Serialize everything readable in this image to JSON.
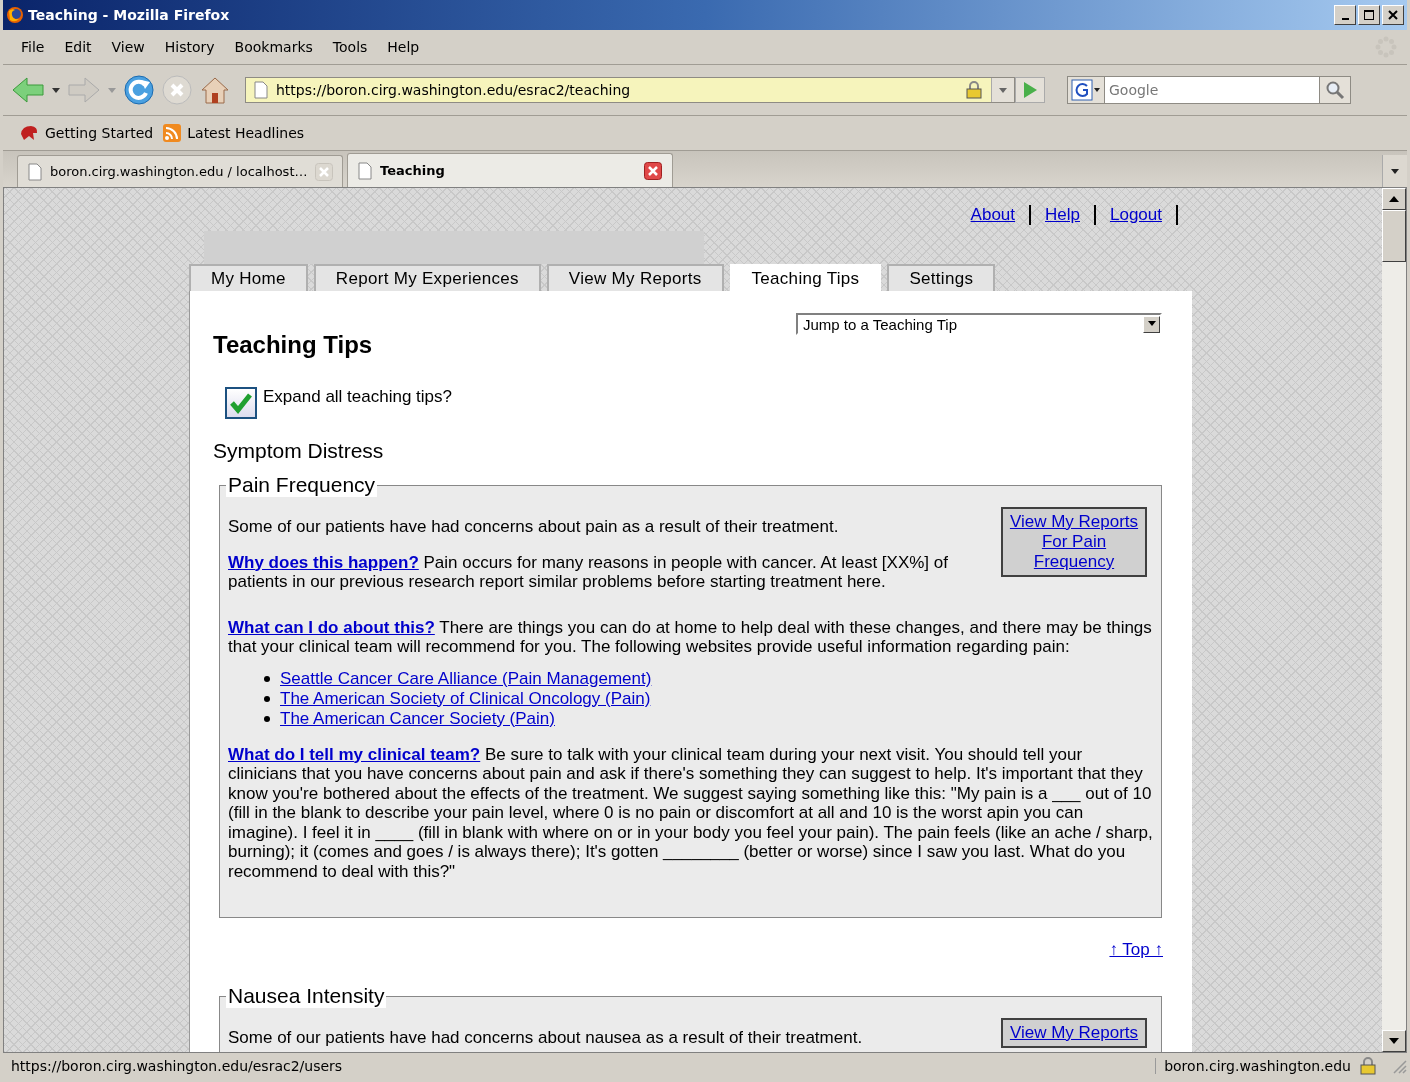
{
  "window": {
    "title": "Teaching - Mozilla Firefox"
  },
  "menu": [
    "File",
    "Edit",
    "View",
    "History",
    "Bookmarks",
    "Tools",
    "Help"
  ],
  "address_bar": {
    "value": "https://boron.cirg.washington.edu/esrac2/teaching"
  },
  "search": {
    "placeholder": "Google"
  },
  "bookmarks": [
    {
      "label": "Getting Started",
      "kind": "start"
    },
    {
      "label": "Latest Headlines",
      "kind": "feed"
    }
  ],
  "browser_tabs": [
    {
      "label": "boron.cirg.washington.edu / localhost…",
      "selected": false
    },
    {
      "label": "Teaching",
      "selected": true
    }
  ],
  "top_links": [
    "About",
    "Help",
    "Logout"
  ],
  "tabs": [
    {
      "label": "My Home",
      "selected": false
    },
    {
      "label": "Report My Experiences",
      "selected": false
    },
    {
      "label": "View My Reports",
      "selected": false
    },
    {
      "label": "Teaching Tips",
      "selected": true
    },
    {
      "label": "Settings",
      "selected": false
    }
  ],
  "heading": "Teaching Tips",
  "jump_select": {
    "value": "Jump to a Teaching Tip"
  },
  "expand_checkbox": {
    "label": "Expand all teaching tips?",
    "checked": true
  },
  "section_title": "Symptom Distress",
  "tips": [
    {
      "title": "Pain Frequency",
      "report_link": "View My Reports For Pain Frequency",
      "intro": "Some of our patients have had concerns about pain as a result of their treatment.",
      "blocks": [
        {
          "lead": "Why does this happen?",
          "text": "Pain occurs for many reasons in people with cancer. At least [XX%] of patients in our previous research report similar problems before starting treatment here."
        },
        {
          "lead": "What can I do about this?",
          "text": "There are things you can do at home to help deal with these changes, and there may be things that your clinical team will recommend for you. The following websites provide useful information regarding pain:",
          "links": [
            "Seattle Cancer Care Alliance (Pain Management)",
            "The American Society of Clinical Oncology (Pain)",
            "The American Cancer Society (Pain)"
          ]
        },
        {
          "lead": "What do I tell my clinical team?",
          "text": "Be sure to talk with your clinical team during your next visit. You should tell your clinicians that you have concerns about pain and ask if there's something they can suggest to help. It's important that they know you're bothered about the effects of the treatment. We suggest saying something like this: \"My pain is a ___ out of 10 (fill in the blank to describe your pain level, where 0 is no pain or discomfort at all and 10 is the worst apin you can imagine). I feel it in ____ (fill in blank with where on or in your body you feel your pain). The pain feels (like an ache / sharp, burning); it (comes and goes / is always there); It's gotten ________ (better or worse) since I saw you last. What do you recommend to deal with this?\""
        }
      ],
      "top_link": "↑ Top ↑"
    },
    {
      "title": "Nausea Intensity",
      "report_link": "View My Reports",
      "intro": "Some of our patients have had concerns about nausea as a result of their treatment."
    }
  ],
  "status_bar": {
    "url": "https://boron.cirg.washington.edu/esrac2/users",
    "host": "boron.cirg.washington.edu"
  }
}
